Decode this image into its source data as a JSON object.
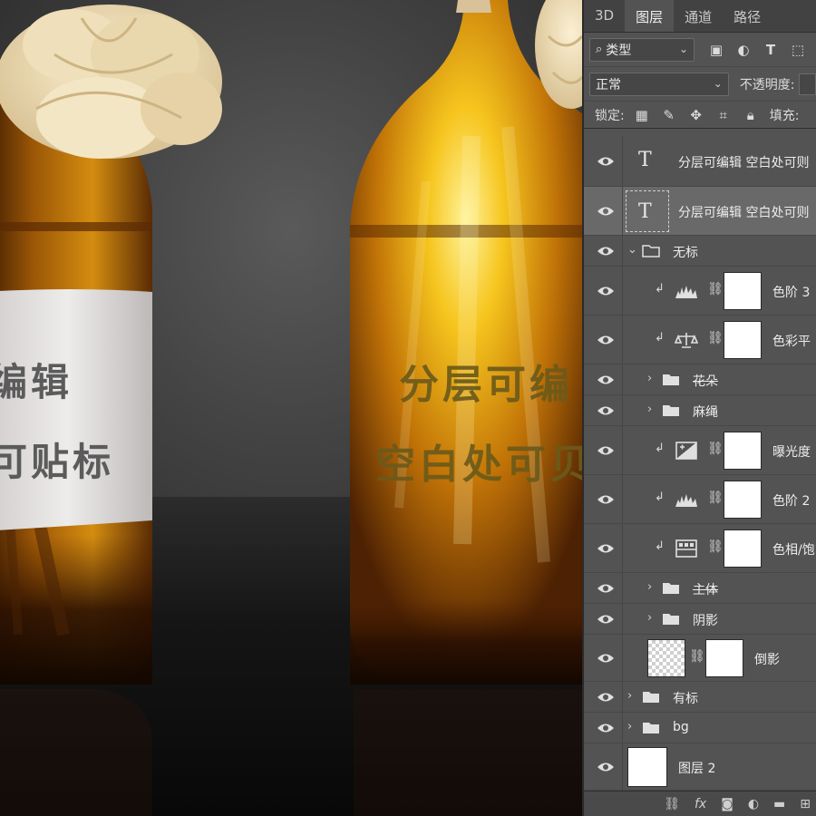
{
  "canvas": {
    "label_text": [
      "编辑",
      "可贴标"
    ],
    "glass_text": [
      "分层可编",
      "空白处可贝"
    ]
  },
  "panel": {
    "tabs": [
      {
        "label": "3D"
      },
      {
        "label": "图层"
      },
      {
        "label": "通道"
      },
      {
        "label": "路径"
      }
    ],
    "filter": {
      "icon": "search-icon",
      "label": "类型"
    },
    "blend_mode": "正常",
    "opacity_label": "不透明度:",
    "lock_label": "锁定:",
    "fill_label": "填充:",
    "layers": [
      {
        "name": "分层可编辑 空白处可则",
        "kind": "text",
        "visible": true
      },
      {
        "name": "分层可编辑 空白处可则",
        "kind": "text",
        "visible": true,
        "selected": true
      },
      {
        "name": "无标",
        "kind": "group",
        "expanded": true,
        "visible": true
      },
      {
        "name": "色阶 3",
        "kind": "adjustment",
        "icon": "levels-icon",
        "clipped": true,
        "visible": true
      },
      {
        "name": "色彩平",
        "kind": "adjustment",
        "icon": "color-balance-icon",
        "clipped": true,
        "visible": true
      },
      {
        "name": "花朵",
        "kind": "group",
        "expanded": false,
        "strike": true,
        "visible": true
      },
      {
        "name": "麻绳",
        "kind": "group",
        "expanded": false,
        "visible": true
      },
      {
        "name": "曝光度",
        "kind": "adjustment",
        "icon": "exposure-icon",
        "clipped": true,
        "visible": true
      },
      {
        "name": "色阶 2",
        "kind": "adjustment",
        "icon": "levels-icon",
        "clipped": true,
        "visible": true
      },
      {
        "name": "色相/饱",
        "kind": "adjustment",
        "icon": "hue-saturation-icon",
        "clipped": true,
        "visible": true
      },
      {
        "name": "主体",
        "kind": "group",
        "expanded": false,
        "strike": true,
        "visible": true
      },
      {
        "name": "阴影",
        "kind": "group",
        "expanded": false,
        "visible": true
      },
      {
        "name": "倒影",
        "kind": "pixel-with-mask",
        "visible": true
      },
      {
        "name": "有标",
        "kind": "group",
        "expanded": false,
        "visible": true
      },
      {
        "name": "bg",
        "kind": "group",
        "expanded": false,
        "visible": true
      },
      {
        "name": "图层 2",
        "kind": "pixel",
        "visible": true
      }
    ],
    "bottom_icons": [
      "link-layers-icon",
      "fx-icon",
      "add-mask-icon",
      "new-adjustment-icon",
      "new-group-icon",
      "new-layer-icon"
    ],
    "bottom_labels": {
      "fx": "fx"
    }
  },
  "colors": {
    "panel_bg": "#535353",
    "selected_row": "#696969",
    "amber_glass": "#c07a0a",
    "label_paper": "#e2e0df"
  }
}
